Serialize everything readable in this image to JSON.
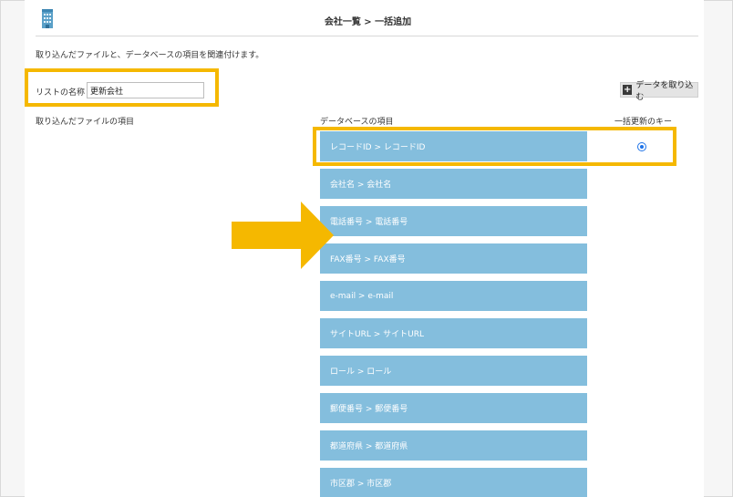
{
  "header": {
    "title": "会社一覧 > 一括追加",
    "icon": "building-icon"
  },
  "instruction": "取り込んだファイルと、データベースの項目を関連付けます。",
  "list_name": {
    "label": "リストの名称",
    "value": "更新会社"
  },
  "import_button": {
    "label": "データを取り込む",
    "icon": "plus-icon"
  },
  "columns": {
    "file_items": "取り込んだファイルの項目",
    "db_items": "データベースの項目",
    "update_key": "一括更新のキー"
  },
  "db_fields": [
    "レコードID > レコードID",
    "会社名 > 会社名",
    "電話番号 > 電話番号",
    "FAX番号 > FAX番号",
    "e-mail > e-mail",
    "サイトURL > サイトURL",
    "ロール > ロール",
    "郵便番号 > 郵便番号",
    "都道府県 > 都道府県",
    "市区郡 > 市区郡"
  ],
  "update_key_selected_index": 0,
  "colors": {
    "highlight": "#f5b800",
    "field_bg": "#84bedd",
    "radio": "#1e73e8"
  }
}
